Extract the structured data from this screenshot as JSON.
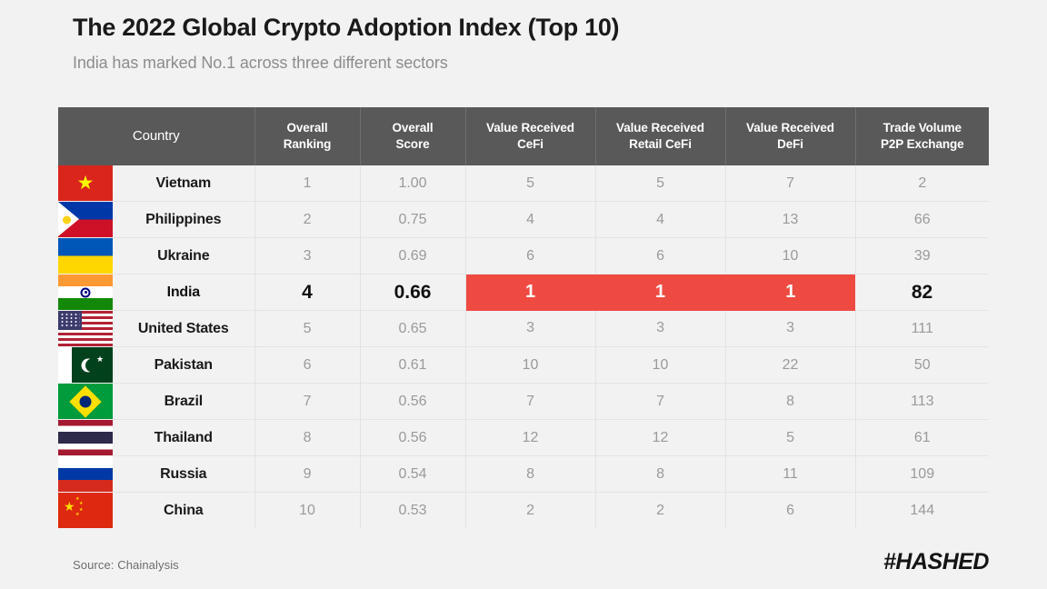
{
  "header": {
    "title": "The 2022 Global Crypto Adoption Index (Top 10)",
    "subtitle": "India has marked No.1 across three different sectors"
  },
  "colors": {
    "background": "#f2f2f2",
    "header_row": "#595959",
    "highlight_red": "#ee4a41",
    "body_text": "#9a9a9a",
    "country_text": "#1a1a1a"
  },
  "table": {
    "columns": [
      "Country",
      "Overall Ranking",
      "Overall Score",
      "Value Received CeFi",
      "Value Received Retail CeFi",
      "Value Received DeFi",
      "Trade Volume P2P Exchange"
    ],
    "columns_lines": [
      [
        "Country"
      ],
      [
        "Overall",
        "Ranking"
      ],
      [
        "Overall",
        "Score"
      ],
      [
        "Value Received",
        "CeFi"
      ],
      [
        "Value Received",
        "Retail CeFi"
      ],
      [
        "Value Received",
        "DeFi"
      ],
      [
        "Trade Volume",
        "P2P Exchange"
      ]
    ],
    "rows": [
      {
        "flag": "vn",
        "country": "Vietnam",
        "overall_ranking": "1",
        "overall_score": "1.00",
        "cefi": "5",
        "retail_cefi": "5",
        "defi": "7",
        "p2p": "2",
        "highlight": false
      },
      {
        "flag": "ph",
        "country": "Philippines",
        "overall_ranking": "2",
        "overall_score": "0.75",
        "cefi": "4",
        "retail_cefi": "4",
        "defi": "13",
        "p2p": "66",
        "highlight": false
      },
      {
        "flag": "ua",
        "country": "Ukraine",
        "overall_ranking": "3",
        "overall_score": "0.69",
        "cefi": "6",
        "retail_cefi": "6",
        "defi": "10",
        "p2p": "39",
        "highlight": false
      },
      {
        "flag": "in",
        "country": "India",
        "overall_ranking": "4",
        "overall_score": "0.66",
        "cefi": "1",
        "retail_cefi": "1",
        "defi": "1",
        "p2p": "82",
        "highlight": true
      },
      {
        "flag": "us",
        "country": "United States",
        "overall_ranking": "5",
        "overall_score": "0.65",
        "cefi": "3",
        "retail_cefi": "3",
        "defi": "3",
        "p2p": "111",
        "highlight": false
      },
      {
        "flag": "pk",
        "country": "Pakistan",
        "overall_ranking": "6",
        "overall_score": "0.61",
        "cefi": "10",
        "retail_cefi": "10",
        "defi": "22",
        "p2p": "50",
        "highlight": false
      },
      {
        "flag": "br",
        "country": "Brazil",
        "overall_ranking": "7",
        "overall_score": "0.56",
        "cefi": "7",
        "retail_cefi": "7",
        "defi": "8",
        "p2p": "113",
        "highlight": false
      },
      {
        "flag": "th",
        "country": "Thailand",
        "overall_ranking": "8",
        "overall_score": "0.56",
        "cefi": "12",
        "retail_cefi": "12",
        "defi": "5",
        "p2p": "61",
        "highlight": false
      },
      {
        "flag": "ru",
        "country": "Russia",
        "overall_ranking": "9",
        "overall_score": "0.54",
        "cefi": "8",
        "retail_cefi": "8",
        "defi": "11",
        "p2p": "109",
        "highlight": false
      },
      {
        "flag": "cn",
        "country": "China",
        "overall_ranking": "10",
        "overall_score": "0.53",
        "cefi": "2",
        "retail_cefi": "2",
        "defi": "6",
        "p2p": "144",
        "highlight": false
      }
    ]
  },
  "chart_data": {
    "type": "table",
    "title": "The 2022 Global Crypto Adoption Index (Top 10)",
    "subtitle": "India has marked No.1 across three different sectors",
    "source": "Chainalysis",
    "columns": [
      "Country",
      "Overall Ranking",
      "Overall Score",
      "Value Received CeFi",
      "Value Received Retail CeFi",
      "Value Received DeFi",
      "Trade Volume P2P Exchange"
    ],
    "rows": [
      [
        "Vietnam",
        1,
        1.0,
        5,
        5,
        7,
        2
      ],
      [
        "Philippines",
        2,
        0.75,
        4,
        4,
        13,
        66
      ],
      [
        "Ukraine",
        3,
        0.69,
        6,
        6,
        10,
        39
      ],
      [
        "India",
        4,
        0.66,
        1,
        1,
        1,
        82
      ],
      [
        "United States",
        5,
        0.65,
        3,
        3,
        3,
        111
      ],
      [
        "Pakistan",
        6,
        0.61,
        10,
        10,
        22,
        50
      ],
      [
        "Brazil",
        7,
        0.56,
        7,
        7,
        8,
        113
      ],
      [
        "Thailand",
        8,
        0.56,
        12,
        12,
        5,
        61
      ],
      [
        "Russia",
        9,
        0.54,
        8,
        8,
        11,
        109
      ],
      [
        "China",
        10,
        0.53,
        2,
        2,
        6,
        144
      ]
    ],
    "highlighted_row": "India",
    "highlighted_cells": [
      "Value Received CeFi",
      "Value Received Retail CeFi",
      "Value Received DeFi"
    ]
  },
  "footer": {
    "source": "Source: Chainalysis",
    "logo": "#HASHED"
  }
}
